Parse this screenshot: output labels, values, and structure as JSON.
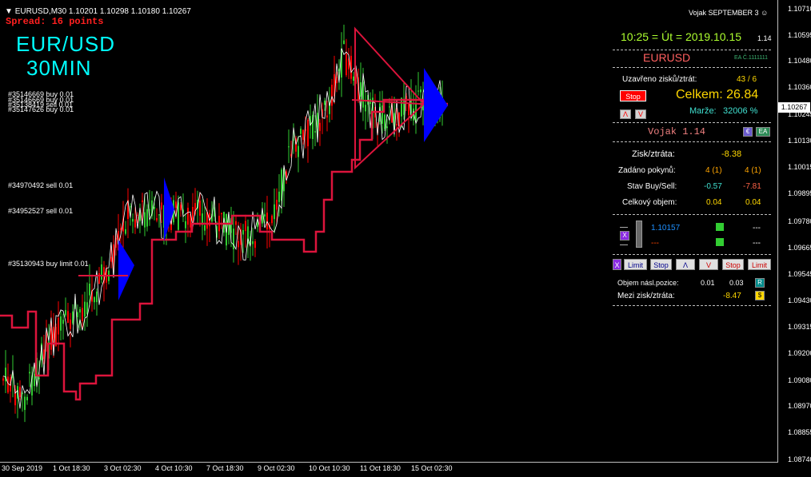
{
  "header": {
    "symbol_line": "EURUSD,M30  1.10201 1.10298 1.10180 1.10267",
    "spread": "Spread: 16 points",
    "logo_pair": "EUR/USD",
    "logo_tf": "30MIN",
    "version_tag": "Vojak SEPTEMBER 3"
  },
  "orders": [
    {
      "text": "#35146669 buy 0.01"
    },
    {
      "text": "#35146669 buy 0.01"
    },
    {
      "text": "#35138419 sell 0.01"
    },
    {
      "text": "#35147626 buy 0.01"
    },
    {
      "text": "#34970492 sell 0.01"
    },
    {
      "text": "#34952527 sell 0.01"
    },
    {
      "text": "#35130943 buy limit 0.01"
    }
  ],
  "price_axis": [
    "1.10710",
    "1.10595",
    "1.10480",
    "1.10360",
    "1.10245",
    "1.10130",
    "1.10015",
    "1.09895",
    "1.09780",
    "1.09665",
    "1.09545",
    "1.09430",
    "1.09315",
    "1.09200",
    "1.09080",
    "1.08970",
    "1.08855",
    "1.08740"
  ],
  "current_price": "1.10267",
  "time_axis": [
    "30 Sep 2019",
    "1 Oct 18:30",
    "3 Oct 02:30",
    "4 Oct 10:30",
    "7 Oct 18:30",
    "9 Oct 02:30",
    "10 Oct 10:30",
    "11 Oct 18:30",
    "15 Oct 02:30"
  ],
  "panel": {
    "clock": "10:25 = Út = 2019.10.15",
    "clock_suffix": "1.14",
    "symbol": "EURUSD",
    "ea_code": "EA Č.1111111",
    "closed_label": "Uzavřeno zisků/ztrát:",
    "closed_value": "43 / 6",
    "stop_btn": "Stop",
    "total_label": "Celkem: 26.84",
    "up_btn": "Λ",
    "down_btn": "V",
    "margin_label": "Marže:",
    "margin_value": "32006 %",
    "ea_name": "Vojak 1.14",
    "e_badge": "€",
    "ea_badge": "EA",
    "pl_label": "Zisk/ztráta:",
    "pl_value": "-8.38",
    "orders_label": "Zadáno pokynů:",
    "orders_buy": "4 (1)",
    "orders_sell": "4 (1)",
    "state_label": "Stav Buy/Sell:",
    "state_buy": "-0.57",
    "state_sell": "-7.81",
    "volume_label": "Celkový objem:",
    "volume_buy": "0.04",
    "volume_sell": "0.04",
    "x_badge": "X",
    "level_price": "1.10157",
    "level_dashes": "---",
    "level_right1": "---",
    "level_right2": "---",
    "buttons": [
      "X",
      "Limit",
      "Stop",
      "Λ",
      "V",
      "Stop",
      "Limit"
    ],
    "next_vol_label": "Objem násl.pozice:",
    "next_vol_1": "0.01",
    "next_vol_2": "0.03",
    "r_badge": "R",
    "inter_label": "Mezi zisk/ztráta:",
    "inter_value": "-8.47",
    "inter_badge": "$"
  },
  "colors": {
    "bull": "#32cd32",
    "bear": "#ff0000",
    "line": "#ffffff",
    "trail": "#dc143c",
    "arrow": "#0000ff",
    "panel_gold": "#ffd700",
    "panel_cyan": "#40e0d0"
  }
}
